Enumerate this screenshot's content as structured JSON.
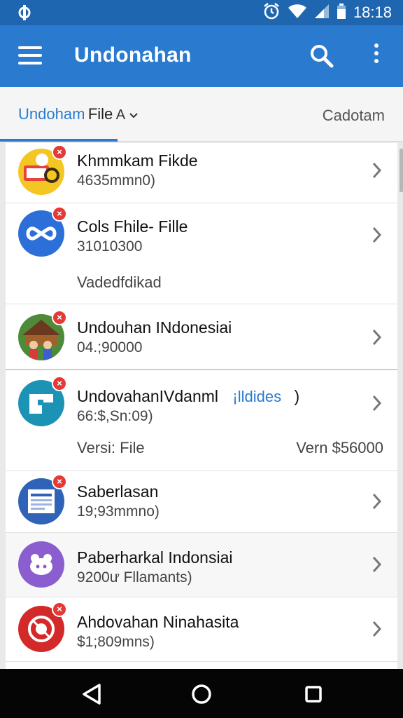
{
  "status_bar": {
    "time": "18:18",
    "left_icon": "pinwheel-icon"
  },
  "app_bar": {
    "title": "Undonahan",
    "menu_icon": "hamburger-menu-icon",
    "search_icon": "search-icon",
    "more_icon": "more-vertical-icon"
  },
  "tabs": {
    "active_label_blue": "Undoham",
    "active_label_dark": "File",
    "active_sort": "A",
    "right_label": "Cadotam"
  },
  "colors": {
    "primary": "#2a7bd0",
    "status_bar": "#1f66b0",
    "badge": "#e53935"
  },
  "items": [
    {
      "title": "Khmmkam Fikde",
      "subtitle": "4635mmn0)",
      "icon": "wallet-cartoon-icon",
      "icon_bg": "#f3c623"
    },
    {
      "title": "Cols Fhile- Fille",
      "subtitle": "31010300",
      "extra": "Vadedfdikad",
      "icon": "infinity-link-icon",
      "icon_bg": "#2d6fd8"
    },
    {
      "title": "Undouhan INdonesiai",
      "subtitle": "04.;90000",
      "icon": "village-people-icon",
      "icon_bg": "#4f8a3a"
    },
    {
      "title": "UndovahanIVdanml",
      "title_blue": "¡lldides",
      "title_tail": ")",
      "subtitle": "66:$,Sn:09)",
      "extra": "Versi: File",
      "extra_right": "Vern $56000",
      "icon": "flag-shape-icon",
      "icon_bg": "#1c93b5"
    },
    {
      "title": "Saberlasan",
      "subtitle": "19;93mmno)",
      "icon": "document-form-icon",
      "icon_bg": "#2f63b8"
    },
    {
      "title": "Paberharkal Indonsiai",
      "subtitle": "9200ư Fllamants)",
      "icon": "toad-mascot-icon",
      "icon_bg": "#8a5ecf"
    },
    {
      "title": "Ahdovahan Ninahasita",
      "subtitle": "$1;809mns)",
      "icon": "red-emblem-icon",
      "icon_bg": "#d32929"
    }
  ],
  "nav": {
    "back": "back-triangle-icon",
    "home": "home-circle-icon",
    "recents": "recents-square-icon"
  }
}
